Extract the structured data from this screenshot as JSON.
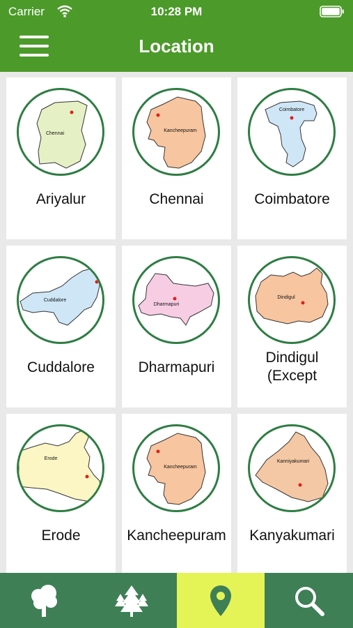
{
  "status": {
    "carrier": "Carrier",
    "time": "10:28 PM"
  },
  "header": {
    "title": "Location"
  },
  "districts": [
    {
      "name": "Ariyalur",
      "map_label": "Chennai",
      "fill": "#e6f0c5"
    },
    {
      "name": "Chennai",
      "map_label": "Kancheepuram",
      "fill": "#f7c59f"
    },
    {
      "name": "Coimbatore",
      "map_label": "Coimbatore",
      "fill": "#cfe6f7"
    },
    {
      "name": "Cuddalore",
      "map_label": "Cuddalore",
      "fill": "#cfe6f7"
    },
    {
      "name": "Dharmapuri",
      "map_label": "Dharmapuri",
      "fill": "#f7cde4"
    },
    {
      "name": "Dindigul\n(Except",
      "map_label": "Dindigul",
      "fill": "#f7c59f"
    },
    {
      "name": "Erode",
      "map_label": "Erode",
      "fill": "#fbf6c4"
    },
    {
      "name": "Kancheepuram",
      "map_label": "Kancheepuram",
      "fill": "#f7c59f"
    },
    {
      "name": "Kanyakumari",
      "map_label": "Kanniyakumari",
      "fill": "#f4c8a4"
    }
  ],
  "tabs": [
    {
      "icon": "tree-icon",
      "active": false
    },
    {
      "icon": "forest-icon",
      "active": false
    },
    {
      "icon": "location-pin-icon",
      "active": true
    },
    {
      "icon": "search-icon",
      "active": false
    }
  ],
  "colors": {
    "primary": "#4c9a2a",
    "tab_bar": "#3e7f56",
    "active_tab": "#e4f457",
    "circle_border": "#2e7d43"
  }
}
